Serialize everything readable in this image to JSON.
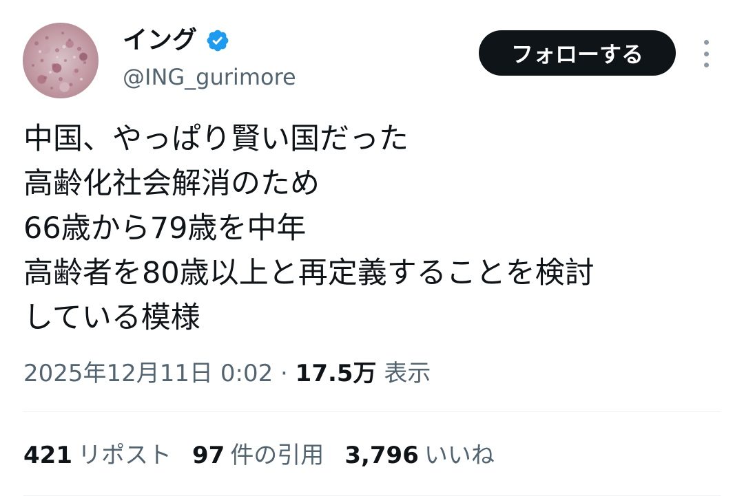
{
  "user": {
    "display_name": "イング",
    "handle": "@ING_gurimore",
    "verified": true
  },
  "follow_button": {
    "label": "フォローする"
  },
  "more_button": {
    "icon": "more-vertical-icon"
  },
  "tweet": {
    "lines": [
      "中国、やっぱり賢い国だった",
      "高齢化社会解消のため",
      "66歳から79歳を中年",
      "高齢者を80歳以上と再定義することを検討",
      "している模様"
    ]
  },
  "meta": {
    "timestamp": "2025年12月11日 0:02",
    "separator": "·",
    "views_count": "17.5万",
    "views_label": "表示"
  },
  "stats": {
    "reposts_count": "421",
    "reposts_label": "リポスト",
    "quotes_count": "97",
    "quotes_label": "件の引用",
    "likes_count": "3,796",
    "likes_label": "いいね"
  },
  "colors": {
    "text_primary": "#0f1419",
    "text_secondary": "#536471",
    "verified_blue": "#1d9bf0",
    "button_bg": "#0f1419",
    "divider": "#eff3f4"
  }
}
